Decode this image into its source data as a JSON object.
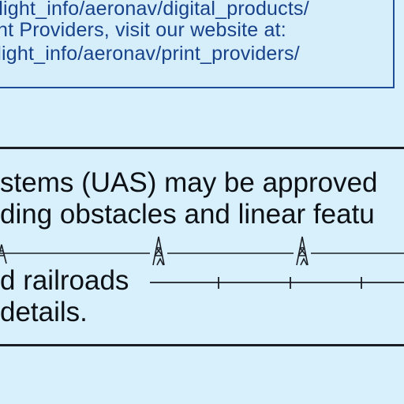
{
  "notice": {
    "line1": "/flight_info/aeronav/digital_products/",
    "line2": "nt Providers, visit our website at:",
    "line3": "/flight_info/aeronav/print_providers/"
  },
  "body": {
    "line1": "stems (UAS) may be approved",
    "line2": "ding obstacles and linear featu",
    "line3": "d  railroads",
    "line4": "details."
  },
  "colors": {
    "background": "#d8f0fb",
    "link_blue": "#17428a",
    "border_blue": "#1d4e97",
    "text": "#0d1116"
  },
  "symbols": {
    "powerline": "tower-icon",
    "railroad": "railroad-icon"
  }
}
